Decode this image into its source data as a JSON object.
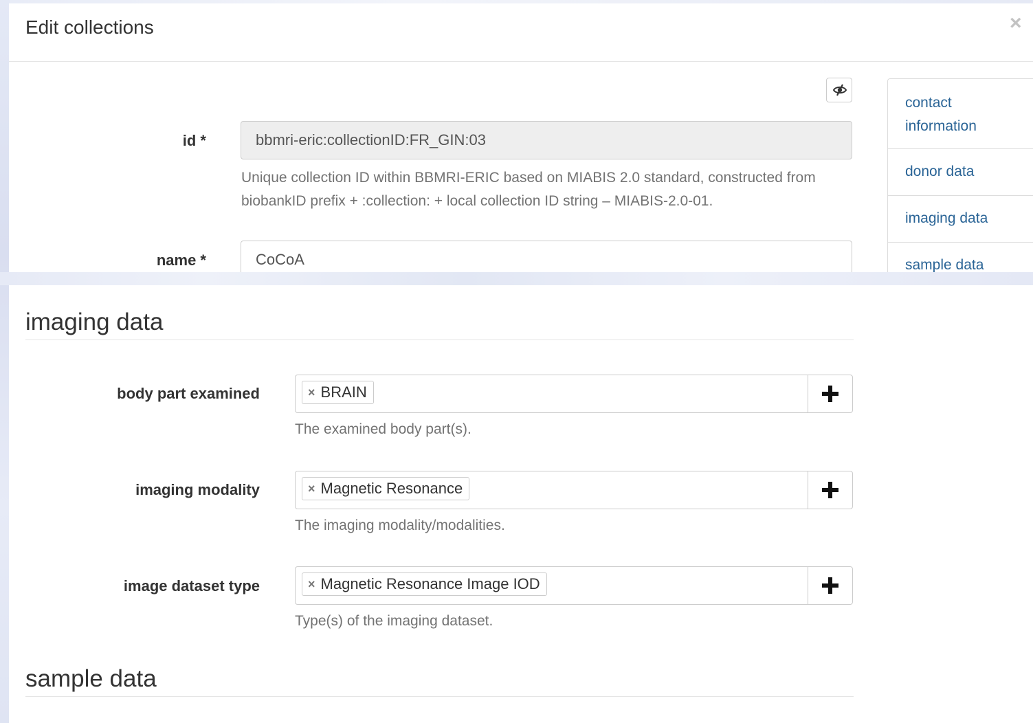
{
  "modal": {
    "title": "Edit collections",
    "close_icon": "×",
    "toggle_icon": "eye-slash-icon",
    "fields": {
      "id": {
        "label": "id *",
        "value": "bbmri-eric:collectionID:FR_GIN:03",
        "help": "Unique collection ID within BBMRI-ERIC based on MIABIS 2.0 standard, constructed from biobankID prefix + :collection: + local collection ID string – MIABIS-2.0-01."
      },
      "name": {
        "label": "name *",
        "value": "CoCoA"
      }
    },
    "nav": {
      "items": [
        {
          "label": "contact information"
        },
        {
          "label": "donor data"
        },
        {
          "label": "imaging data"
        },
        {
          "label": "sample data"
        }
      ]
    }
  },
  "imaging_section": {
    "heading": "imaging data",
    "rows": [
      {
        "label": "body part examined",
        "tag": "BRAIN",
        "help": "The examined body part(s)."
      },
      {
        "label": "imaging modality",
        "tag": "Magnetic Resonance",
        "help": "The imaging modality/modalities."
      },
      {
        "label": "image dataset type",
        "tag": "Magnetic Resonance Image IOD",
        "help": "Type(s) of the imaging dataset."
      }
    ],
    "tag_remove_icon": "×"
  },
  "sample_section": {
    "heading": "sample data"
  },
  "colors": {
    "link": "#2a6496",
    "help_text": "#737373",
    "readonly_bg": "#eeeeee"
  }
}
